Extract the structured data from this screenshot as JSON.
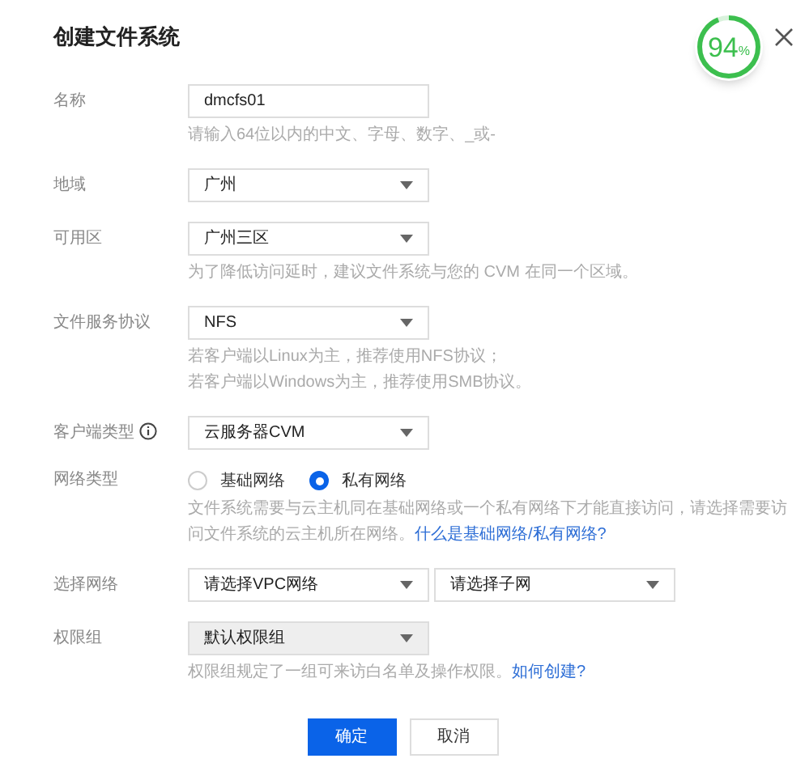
{
  "dialog": {
    "title": "创建文件系统"
  },
  "meter": {
    "value": "94",
    "unit": "%",
    "level": 0.94
  },
  "fields": [
    {
      "kind": "input",
      "label": "名称",
      "value": "dmcfs01",
      "hints": [
        "请输入64位以内的中文、字母、数字、_或-"
      ]
    },
    {
      "kind": "select",
      "label": "地域",
      "value": "广州"
    },
    {
      "kind": "select",
      "label": "可用区",
      "value": "广州三区",
      "hints": [
        "为了降低访问延时，建议文件系统与您的 CVM 在同一个区域。"
      ]
    },
    {
      "kind": "select",
      "label": "文件服务协议",
      "value": "NFS",
      "hints": [
        "若客户端以Linux为主，推荐使用NFS协议；",
        "若客户端以Windows为主，推荐使用SMB协议。"
      ]
    },
    {
      "kind": "select",
      "label": "客户端类型",
      "info": true,
      "value": "云服务器CVM"
    },
    {
      "kind": "radio",
      "label": "网络类型",
      "options": [
        {
          "label": "基础网络",
          "selected": false
        },
        {
          "label": "私有网络",
          "selected": true
        }
      ],
      "note": {
        "text": "文件系统需要与云主机同在基础网络或一个私有网络下才能直接访问，请选择需要访问文件系统的云主机所在网络。",
        "link": "什么是基础网络/私有网络?"
      }
    },
    {
      "kind": "select-pair",
      "label": "选择网络",
      "values": [
        "请选择VPC网络",
        "请选择子网"
      ]
    },
    {
      "kind": "select",
      "label": "权限组",
      "value": "默认权限组",
      "disabled": true,
      "note": {
        "text": "权限组规定了一组可来访白名单及操作权限。",
        "link": "如何创建?"
      }
    }
  ],
  "buttons": [
    {
      "label": "确定",
      "primary": true
    },
    {
      "label": "取消",
      "primary": false
    }
  ]
}
